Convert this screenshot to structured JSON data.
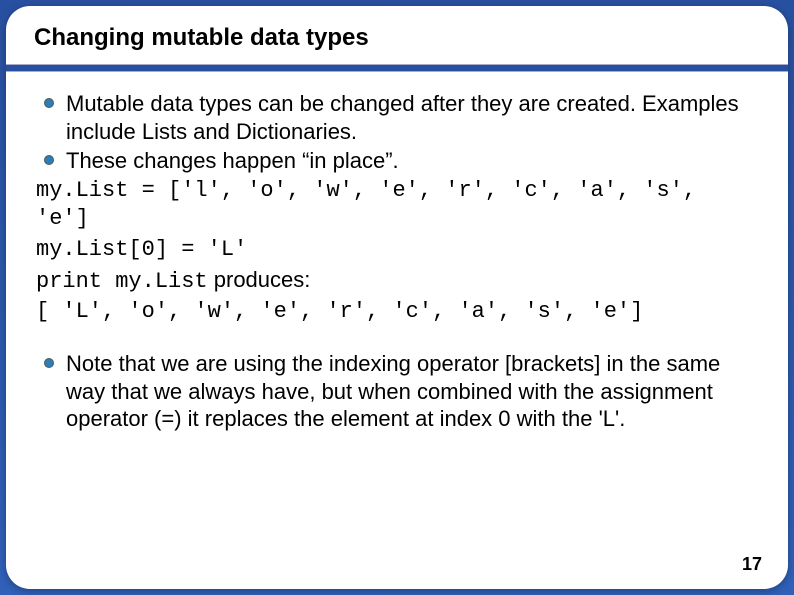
{
  "title": "Changing mutable data types",
  "bullets_top": [
    "Mutable data types can  be changed after they are created.  Examples include Lists and Dictionaries.",
    "These changes happen “in place”."
  ],
  "code": {
    "line1": "my.List = ['l', 'o', 'w', 'e', 'r', 'c', 'a', 's', 'e']",
    "line2": "my.List[0] = 'L'",
    "line3_code": "print my.List",
    "line3_text": " produces:",
    "line4": "[ 'L', 'o', 'w', 'e', 'r', 'c', 'a', 's', 'e']"
  },
  "bullets_bottom": [
    "Note that we are using the indexing operator [brackets] in the same way that we always have, but when combined with the assignment operator (=) it replaces the element at index 0 with the 'L'."
  ],
  "page_number": "17"
}
